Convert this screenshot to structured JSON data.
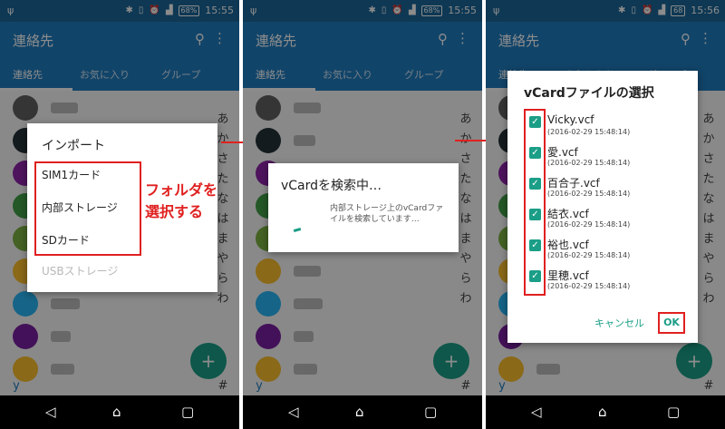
{
  "statusbar": {
    "battery": "68%",
    "battery_p3": "68",
    "time_p1": "15:55",
    "time_p2": "15:55",
    "time_p3": "15:56"
  },
  "appbar": {
    "title": "連絡先"
  },
  "tabs": [
    "連絡先",
    "お気に入り",
    "グループ"
  ],
  "index_letters": [
    "あ",
    "か",
    "さ",
    "た",
    "な",
    "は",
    "ま",
    "や",
    "ら",
    "わ",
    "#"
  ],
  "index_letter_y": "y",
  "dialog_import": {
    "title": "インポート",
    "options": [
      "SIM1カード",
      "内部ストレージ",
      "SDカード",
      "USBストレージ"
    ]
  },
  "annotation": {
    "line1": "フォルダを",
    "line2": "選択する"
  },
  "dialog_search": {
    "title": "vCardを検索中…",
    "message": "内部ストレージ上のvCardファイルを検索しています…"
  },
  "dialog_select": {
    "title": "vCardファイルの選択",
    "items": [
      {
        "name": "Vicky.vcf",
        "date": "(2016-02-29 15:48:14)",
        "checked": true
      },
      {
        "name": "愛.vcf",
        "date": "(2016-02-29 15:48:14)",
        "checked": true
      },
      {
        "name": "百合子.vcf",
        "date": "(2016-02-29 15:48:14)",
        "checked": true
      },
      {
        "name": "結衣.vcf",
        "date": "(2016-02-29 15:48:14)",
        "checked": true
      },
      {
        "name": "裕也.vcf",
        "date": "(2016-02-29 15:48:14)",
        "checked": true
      },
      {
        "name": "里穂.vcf",
        "date": "(2016-02-29 15:48:14)",
        "checked": true
      }
    ],
    "cancel": "キャンセル",
    "ok": "OK"
  },
  "colors": {
    "primary": "#1f7cc0",
    "statusbar": "#1a6699",
    "accent": "#1b9e87",
    "highlight": "#e02020"
  },
  "icons": {
    "search": "search-icon",
    "more": "more-vert-icon",
    "add": "add-icon",
    "back": "back-icon",
    "home": "home-icon",
    "recent": "recent-apps-icon"
  }
}
